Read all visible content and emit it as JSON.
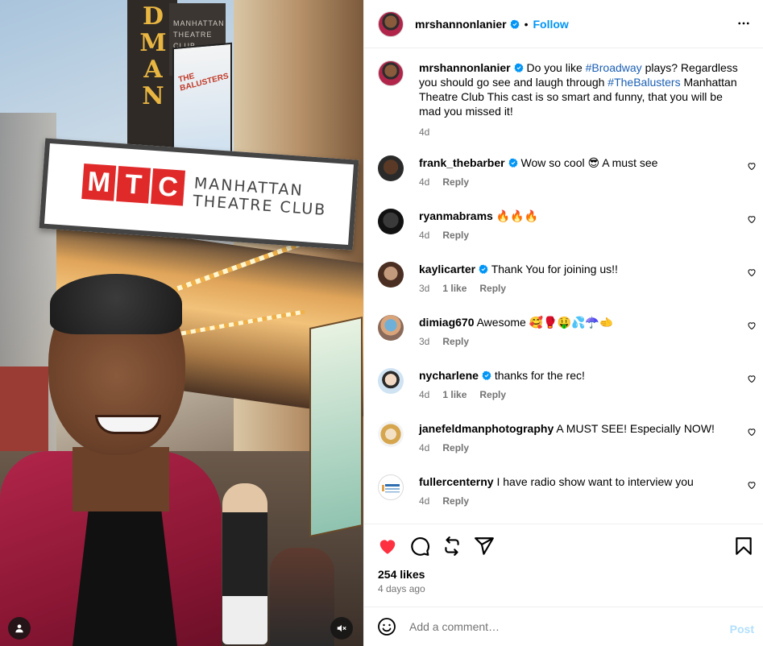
{
  "media": {
    "tower_letters": [
      "D",
      "M",
      "A",
      "N"
    ],
    "tower_panel_text": [
      "MANHATTAN",
      "THEATRE",
      "CLUB"
    ],
    "poster_title": "THE BALUSTERS",
    "sign_logo": [
      "M",
      "T",
      "C"
    ],
    "sign_text_line1": "MANHATTAN",
    "sign_text_line2": "THEATRE CLUB"
  },
  "header": {
    "username": "mrshannonlanier",
    "separator": "•",
    "follow_label": "Follow"
  },
  "caption": {
    "username": "mrshannonlanier",
    "text_before": " Do you like ",
    "hashtag1": "#Broadway",
    "text_middle": " plays? Regardless you should go see and laugh through ",
    "hashtag2": "#TheBalusters",
    "text_after": " Manhattan Theatre Club This cast is so smart and funny, that you will be mad you missed it!",
    "time": "4d"
  },
  "comments": [
    {
      "username": "frank_thebarber",
      "verified": true,
      "text": " Wow so cool 😎 A must see",
      "time": "4d",
      "likes": "",
      "reply": "Reply"
    },
    {
      "username": "ryanmabrams",
      "verified": false,
      "text": " 🔥🔥🔥",
      "time": "4d",
      "likes": "",
      "reply": "Reply"
    },
    {
      "username": "kaylicarter",
      "verified": true,
      "text": " Thank You for joining us!!",
      "time": "3d",
      "likes": "1 like",
      "reply": "Reply"
    },
    {
      "username": "dimiag670",
      "verified": false,
      "text": " Awesome 🥰🥊🤑💦☂️🫲",
      "time": "3d",
      "likes": "",
      "reply": "Reply"
    },
    {
      "username": "nycharlene",
      "verified": true,
      "text": " thanks for the rec!",
      "time": "4d",
      "likes": "1 like",
      "reply": "Reply"
    },
    {
      "username": "janefeldmanphotography",
      "verified": false,
      "text": " A MUST SEE! Especially NOW!",
      "time": "4d",
      "likes": "",
      "reply": "Reply"
    },
    {
      "username": "fullercenterny",
      "verified": false,
      "text": " I have radio show want to interview you",
      "time": "4d",
      "likes": "",
      "reply": "Reply"
    }
  ],
  "stats": {
    "likes": "254 likes",
    "date": "4 days ago"
  },
  "composer": {
    "placeholder": "Add a comment…",
    "post_label": "Post"
  },
  "colors": {
    "accent": "#0095f6",
    "liked_heart": "#ff3040",
    "muted": "#737373",
    "post_disabled": "#b2dffc"
  },
  "icons": [
    "verified-badge-icon",
    "more-options-icon",
    "heart-icon",
    "comment-icon",
    "repost-icon",
    "share-icon",
    "bookmark-icon",
    "emoji-icon",
    "user-tag-icon",
    "mute-icon"
  ]
}
